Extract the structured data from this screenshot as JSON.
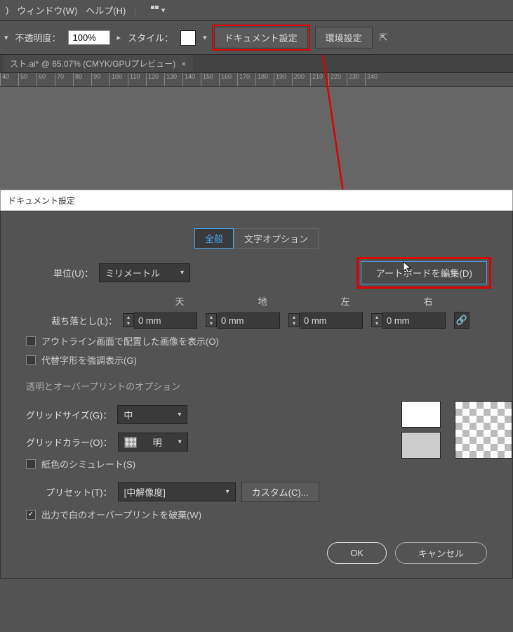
{
  "menu": {
    "window": "ウィンドウ(W)",
    "help": "ヘルプ(H)",
    "view_suffix": ")"
  },
  "toolbar": {
    "opacity_label": "不透明度：",
    "opacity_value": "100%",
    "style_label": "スタイル：",
    "doc_setup": "ドキュメント設定",
    "prefs": "環境設定"
  },
  "doc_tab": {
    "title": "スト.ai* @ 65.07% (CMYK/GPUプレビュー)"
  },
  "ruler_ticks": [
    "40",
    "50",
    "60",
    "70",
    "80",
    "90",
    "100",
    "110",
    "120",
    "130",
    "140",
    "150",
    "160",
    "170",
    "180",
    "190",
    "200",
    "210",
    "220",
    "230",
    "240"
  ],
  "dialog": {
    "title": "ドキュメント設定",
    "tab_general": "全般",
    "tab_text": "文字オプション",
    "units_label": "単位(U)：",
    "units_value": "ミリメートル",
    "artboard_btn": "アートボードを編集(D)",
    "bleed": {
      "top": "天",
      "bottom": "地",
      "left": "左",
      "right": "右",
      "label": "裁ち落とし(L)：",
      "val_top": "0 mm",
      "val_bottom": "0 mm",
      "val_left": "0 mm",
      "val_right": "0 mm"
    },
    "cb_outline": "アウトライン画面で配置した画像を表示(O)",
    "cb_glyphs": "代替字形を強調表示(G)",
    "section_trans": "透明とオーバープリントのオプション",
    "grid_size_label": "グリッドサイズ(G)：",
    "grid_size_value": "中",
    "grid_color_label": "グリッドカラー(O)：",
    "grid_color_value": "明",
    "cb_paper": "紙色のシミュレート(S)",
    "preset_label": "プリセット(T)：",
    "preset_value": "[中解像度]",
    "custom_btn": "カスタム(C)...",
    "cb_overprint": "出力で白のオーバープリントを破棄(W)",
    "ok": "OK",
    "cancel": "キャンセル"
  }
}
